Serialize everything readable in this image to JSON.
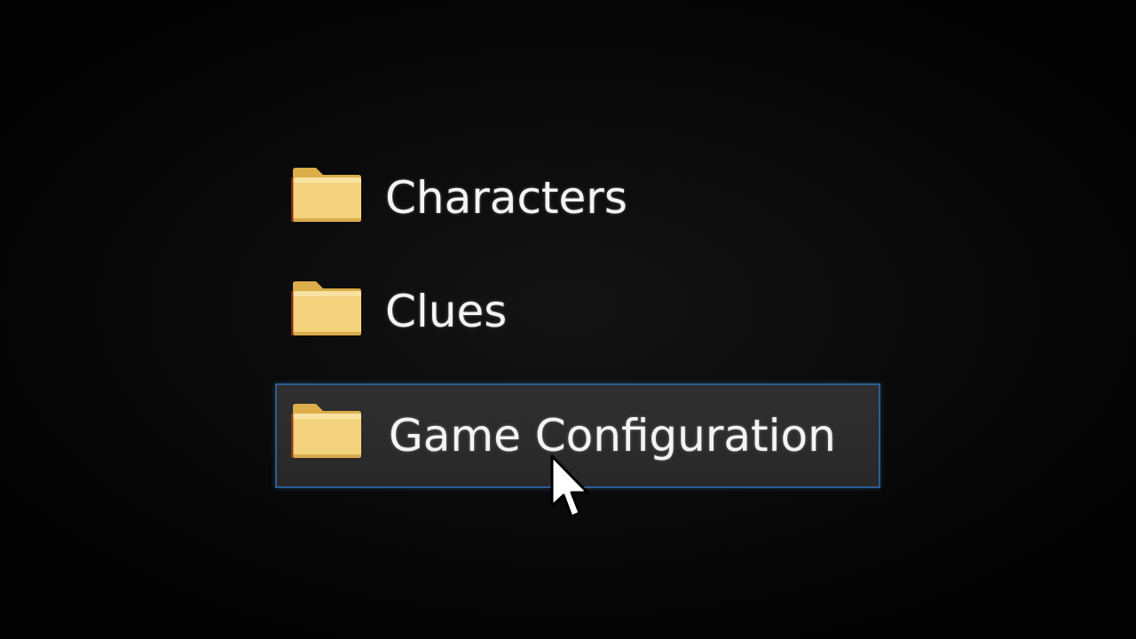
{
  "folders": [
    {
      "label": "Characters",
      "icon": "folder-icon",
      "selected": false
    },
    {
      "label": "Clues",
      "icon": "folder-icon",
      "selected": false
    },
    {
      "label": "Game Configuration",
      "icon": "folder-icon",
      "selected": true
    }
  ],
  "colors": {
    "background": "#000000",
    "selection_fill": "#2b2b2b",
    "selection_border": "#2d5d92",
    "folder_body": "#f3d27a",
    "folder_tab": "#e1b451",
    "text": "#f4f4f4"
  },
  "cursor": {
    "icon": "arrow-cursor-icon"
  }
}
